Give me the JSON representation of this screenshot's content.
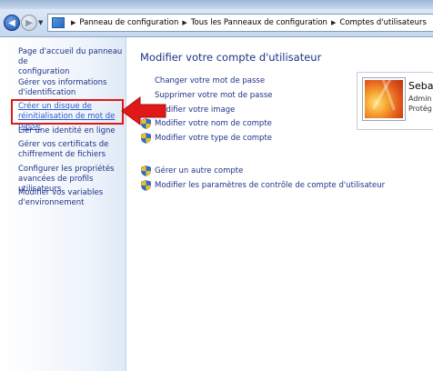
{
  "breadcrumb": [
    "Panneau de configuration",
    "Tous les Panneaux de configuration",
    "Comptes d'utilisateurs"
  ],
  "left_pane": {
    "home_link": [
      "Page d'accueil du panneau de",
      "configuration"
    ],
    "links": [
      [
        "Gérer vos informations",
        "d'identification"
      ],
      [
        "Créer un disque de",
        "réinitialisation de mot de passe"
      ],
      [
        "Lier une identité en ligne"
      ],
      [
        "Gérer vos certificats de",
        "chiffrement de fichiers"
      ],
      [
        "Configurer les propriétés",
        "avancées de profils utilisateurs"
      ],
      [
        "Modifier vos variables",
        "d'environnement"
      ]
    ]
  },
  "main": {
    "title": "Modifier votre compte d'utilisateur",
    "tasks": [
      "Changer votre mot de passe",
      "Supprimer votre mot de passe",
      "Modifier votre image",
      "Modifier votre nom de compte",
      "Modifier votre type de compte"
    ],
    "other_tasks": [
      "Gérer un autre compte",
      "Modifier les paramètres de contrôle de compte d'utilisateur"
    ]
  },
  "user_tile": {
    "name": "Seba",
    "role": "Admin",
    "status": "Protég"
  },
  "colors": {
    "link": "#1e3287",
    "highlight_box": "#e01818",
    "arrow": "#e01818"
  },
  "icons": {
    "back": "back-arrow-icon",
    "forward": "forward-arrow-icon",
    "control_panel": "control-panel-icon",
    "shield": "uac-shield-icon"
  }
}
